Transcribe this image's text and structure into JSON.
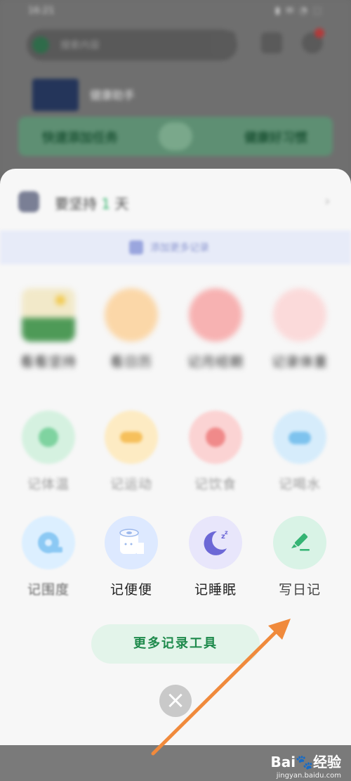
{
  "background_app": {
    "status_time": "16:21",
    "status_icons": "▮ ✉ ◔ ⬚",
    "search_placeholder": "搜索内容",
    "banner_title": "健康助手",
    "promo_left": "快速添加任务",
    "promo_right": "健康好习惯"
  },
  "sheet": {
    "title_prefix": "要坚持",
    "title_highlight": "1",
    "title_suffix": "天",
    "header_arrow": "›",
    "info_text": "添加更多记录"
  },
  "tools_row1": [
    {
      "label": "看看坚持",
      "icon": "scene-icon",
      "color": "#f2e9c9"
    },
    {
      "label": "看日历",
      "icon": "cloud-icon",
      "color": "#fbd7a8"
    },
    {
      "label": "记月经期",
      "icon": "circle-icon",
      "color": "#f7b2b2"
    },
    {
      "label": "记录体重",
      "icon": "scale-icon",
      "color": "#fbdada"
    }
  ],
  "tools_row2": [
    {
      "label": "记体温",
      "icon": "thermometer-icon",
      "color": "#d5f1e0",
      "inner": "#7fd3a0"
    },
    {
      "label": "记运动",
      "icon": "sport-icon",
      "color": "#fdebc3",
      "inner": "#f6c05c"
    },
    {
      "label": "记饮食",
      "icon": "food-icon",
      "color": "#fbd3d3",
      "inner": "#f08a8a"
    },
    {
      "label": "记喝水",
      "icon": "water-icon",
      "color": "#d6ecfb",
      "inner": "#7ec3ee"
    }
  ],
  "tools_row3": [
    {
      "label": "记围度",
      "icon": "tape-measure-icon",
      "color": "#dcefff",
      "inner": "#8cc9f4"
    },
    {
      "label": "记便便",
      "icon": "toilet-paper-icon",
      "color": "#dde9ff",
      "inner": "#9db9ec"
    },
    {
      "label": "记睡眠",
      "icon": "moon-icon",
      "color": "#e8e6fb",
      "inner": "#6c68d6"
    },
    {
      "label": "写日记",
      "icon": "pen-icon",
      "color": "#d9f3e6",
      "inner": "#35b474"
    }
  ],
  "more_tools_button": "更多记录工具",
  "close_icon": "×",
  "watermark": {
    "brand_left": "Bai",
    "brand_paw": "🐾",
    "brand_right": "经验",
    "sub": "jingyan.baidu.com"
  },
  "colors": {
    "accent_green": "#1e8a4c",
    "arrow_orange": "#f08a3c"
  }
}
